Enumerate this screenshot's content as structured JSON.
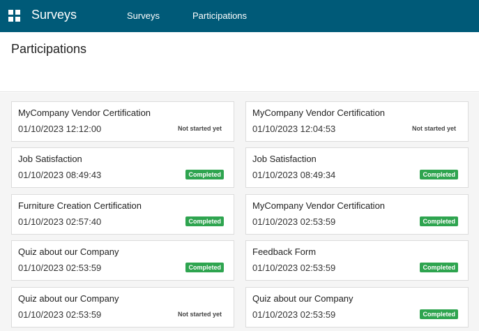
{
  "app": {
    "title": "Surveys"
  },
  "nav": {
    "surveys": "Surveys",
    "participations": "Participations"
  },
  "page": {
    "title": "Participations"
  },
  "colors": {
    "topbar": "#005a78",
    "completed_badge": "#2ea44f"
  },
  "participations": [
    {
      "name": "MyCompany Vendor Certification",
      "date": "01/10/2023 12:12:00",
      "status": "Not started yet",
      "state": "pending"
    },
    {
      "name": "MyCompany Vendor Certification",
      "date": "01/10/2023 12:04:53",
      "status": "Not started yet",
      "state": "pending"
    },
    {
      "name": "Job Satisfaction",
      "date": "01/10/2023 08:49:43",
      "status": "Completed",
      "state": "completed"
    },
    {
      "name": "Job Satisfaction",
      "date": "01/10/2023 08:49:34",
      "status": "Completed",
      "state": "completed"
    },
    {
      "name": "Furniture Creation Certification",
      "date": "01/10/2023 02:57:40",
      "status": "Completed",
      "state": "completed"
    },
    {
      "name": "MyCompany Vendor Certification",
      "date": "01/10/2023 02:53:59",
      "status": "Completed",
      "state": "completed"
    },
    {
      "name": "Quiz about our Company",
      "date": "01/10/2023 02:53:59",
      "status": "Completed",
      "state": "completed"
    },
    {
      "name": "Feedback Form",
      "date": "01/10/2023 02:53:59",
      "status": "Completed",
      "state": "completed"
    },
    {
      "name": "Quiz about our Company",
      "date": "01/10/2023 02:53:59",
      "status": "Not started yet",
      "state": "pending"
    },
    {
      "name": "Quiz about our Company",
      "date": "01/10/2023 02:53:59",
      "status": "Completed",
      "state": "completed"
    }
  ]
}
